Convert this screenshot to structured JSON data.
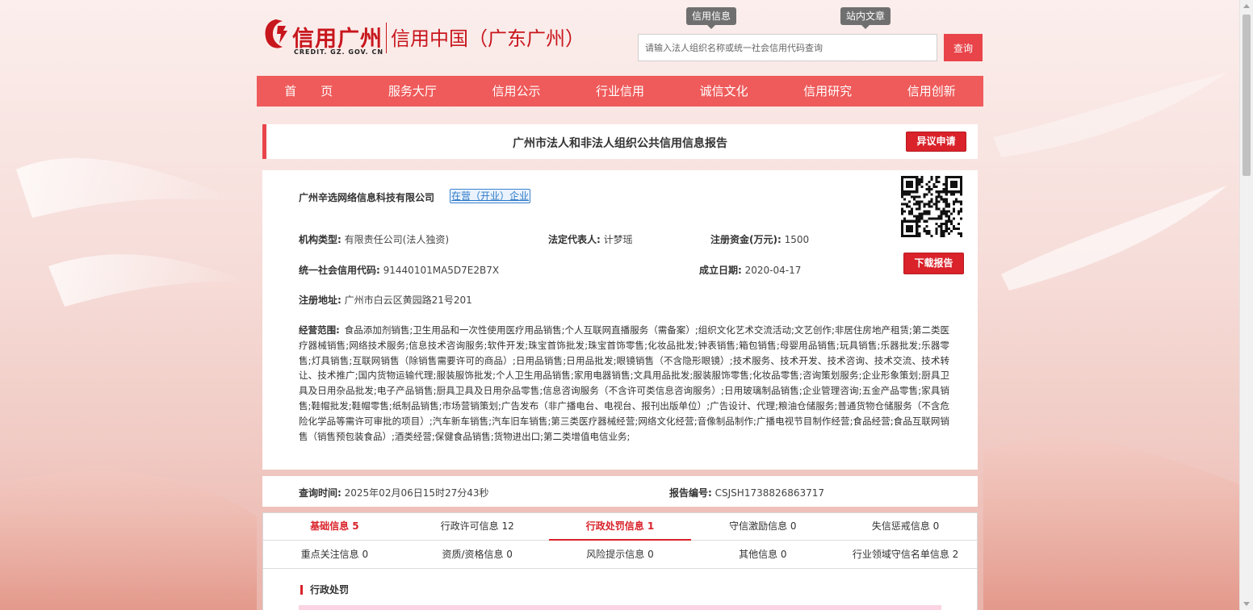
{
  "header": {
    "brand": "信用广州",
    "domain": "CREDIT. GZ. GOV. CN",
    "subtitle": "信用中国（广东广州）",
    "search_tabs": [
      "信用信息",
      "站内文章"
    ],
    "search_placeholder": "请输入法人组织名称或统一社会信用代码查询",
    "search_button": "查询"
  },
  "nav": [
    "首　　页",
    "服务大厅",
    "信用公示",
    "行业信用",
    "诚信文化",
    "信用研究",
    "信用创新"
  ],
  "report": {
    "title": "广州市法人和非法人组织公共信用信息报告",
    "objection_button": "异议申请",
    "download_button": "下载报告"
  },
  "company": {
    "name": "广州辛选网络信息科技有限公司",
    "status": "在营（开业）企业",
    "org_type_label": "机构类型:",
    "org_type": "有限责任公司(法人独资)",
    "legal_rep_label": "法定代表人:",
    "legal_rep": "计梦瑶",
    "capital_label": "注册资金(万元):",
    "capital": "1500",
    "credit_code_label": "统一社会信用代码:",
    "credit_code": "91440101MA5D7E2B7X",
    "founded_label": "成立日期:",
    "founded": "2020-04-17",
    "address_label": "注册地址:",
    "address": "广州市白云区黄园路21号201",
    "scope_label": "经营范围:",
    "scope": "食品添加剂销售;卫生用品和一次性使用医疗用品销售;个人互联网直播服务（需备案）;组织文化艺术交流活动;文艺创作;非居住房地产租赁;第二类医疗器械销售;网络技术服务;信息技术咨询服务;软件开发;珠宝首饰批发;珠宝首饰零售;化妆品批发;钟表销售;箱包销售;母婴用品销售;玩具销售;乐器批发;乐器零售;灯具销售;互联网销售（除销售需要许可的商品）;日用品销售;日用品批发;眼镜销售（不含隐形眼镜）;技术服务、技术开发、技术咨询、技术交流、技术转让、技术推广;国内货物运输代理;服装服饰批发;个人卫生用品销售;家用电器销售;文具用品批发;服装服饰零售;化妆品零售;咨询策划服务;企业形象策划;厨具卫具及日用杂品批发;电子产品销售;厨具卫具及日用杂品零售;信息咨询服务（不含许可类信息咨询服务）;日用玻璃制品销售;企业管理咨询;五金产品零售;家具销售;鞋帽批发;鞋帽零售;纸制品销售;市场营销策划;广告发布（非广播电台、电视台、报刊出版单位）;广告设计、代理;粮油仓储服务;普通货物仓储服务（不含危险化学品等需许可审批的项目）;汽车新车销售;汽车旧车销售;第三类医疗器械经营;网络文化经营;音像制品制作;广播电视节目制作经营;食品经营;食品互联网销售（销售预包装食品）;酒类经营;保健食品销售;货物进出口;第二类增值电信业务;"
  },
  "query": {
    "time_label": "查询时间:",
    "time": "2025年02月06日15时27分43秒",
    "report_no_label": "报告编号:",
    "report_no": "CSJSH1738826863717"
  },
  "tabs_row1": [
    {
      "label": "基础信息 5",
      "red": true
    },
    {
      "label": "行政许可信息 12",
      "red": false
    },
    {
      "label": "行政处罚信息 1",
      "red": true
    },
    {
      "label": "守信激励信息 0",
      "red": false
    },
    {
      "label": "失信惩戒信息 0",
      "red": false
    }
  ],
  "tabs_row2": [
    "重点关注信息 0",
    "资质/资格信息 0",
    "风险提示信息 0",
    "其他信息 0",
    "行业领域守信名单信息 2"
  ],
  "section_title": "行政处罚",
  "colors": {
    "nav": "#ef5a5a",
    "accent": "#d9222a",
    "link": "#2c78c6"
  }
}
